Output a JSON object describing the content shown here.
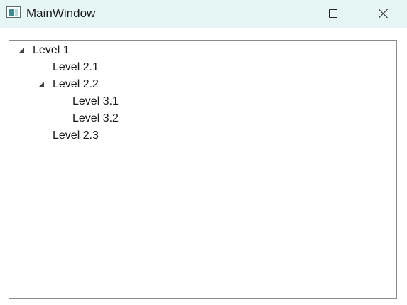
{
  "window": {
    "title": "MainWindow"
  },
  "tree": {
    "items": [
      {
        "label": "Level 1",
        "expanded": true
      },
      {
        "label": "Level 2.1"
      },
      {
        "label": "Level 2.2",
        "expanded": true
      },
      {
        "label": "Level 3.1"
      },
      {
        "label": "Level 3.2"
      },
      {
        "label": "Level 2.3"
      }
    ]
  },
  "icons": {
    "app": "window-app-icon",
    "minimize": "minimize-icon",
    "maximize": "maximize-icon",
    "close": "close-icon",
    "expander": "expanded-triangle-icon"
  },
  "colors": {
    "titlebar": "#e6f6f4",
    "border": "#8c8c8c",
    "text": "#1a1a1a"
  }
}
